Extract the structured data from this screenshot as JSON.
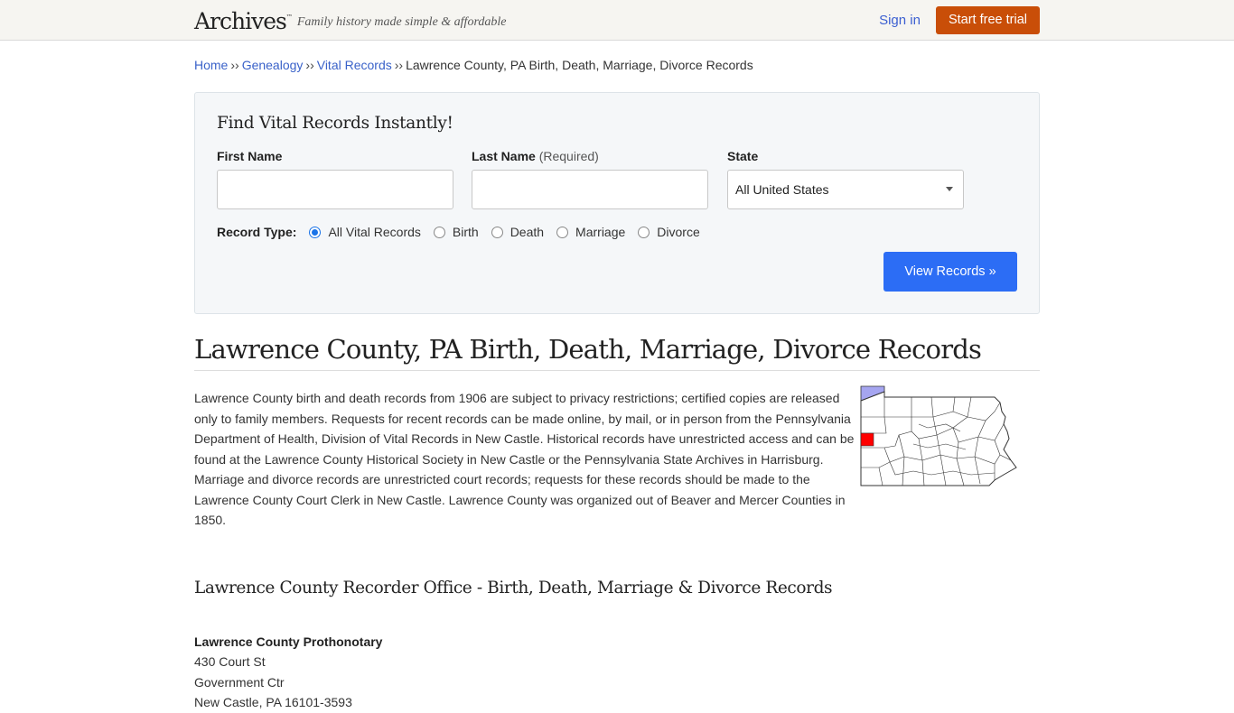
{
  "header": {
    "logo": "Archives",
    "logo_mark": "™",
    "tagline": "Family history made simple & affordable",
    "sign_in": "Sign in",
    "trial_button": "Start free trial"
  },
  "breadcrumb": {
    "items": [
      "Home",
      "Genealogy",
      "Vital Records"
    ],
    "separator": "››",
    "current": "Lawrence County, PA Birth, Death, Marriage, Divorce Records"
  },
  "search": {
    "title": "Find Vital Records Instantly!",
    "first_name_label": "First Name",
    "first_name_value": "",
    "last_name_label": "Last Name",
    "last_name_required": "(Required)",
    "last_name_value": "",
    "state_label": "State",
    "state_value": "All United States",
    "record_type_label": "Record Type:",
    "record_types": [
      {
        "label": "All Vital Records",
        "checked": true
      },
      {
        "label": "Birth",
        "checked": false
      },
      {
        "label": "Death",
        "checked": false
      },
      {
        "label": "Marriage",
        "checked": false
      },
      {
        "label": "Divorce",
        "checked": false
      }
    ],
    "submit": "View Records »"
  },
  "main": {
    "title": "Lawrence County, PA Birth, Death, Marriage, Divorce Records",
    "description": "Lawrence County birth and death records from 1906 are subject to privacy restrictions; certified copies are released only to family members. Requests for recent records can be made online, by mail, or in person from the Pennsylvania Department of Health, Division of Vital Records in New Castle. Historical records have unrestricted access and can be found at the Lawrence County Historical Society in New Castle or the Pennsylvania State Archives in Harrisburg. Marriage and divorce records are unrestricted court records; requests for these records should be made to the Lawrence County Court Clerk in New Castle. Lawrence County was organized out of Beaver and Mercer Counties in 1850.",
    "map_highlight_color": "#ff0000",
    "map_lake_color": "#a5a5f0",
    "office_heading": "Lawrence County Recorder Office - Birth, Death, Marriage & Divorce Records",
    "office": {
      "name": "Lawrence County Prothonotary",
      "address_lines": [
        "430 Court St",
        "Government Ctr",
        "New Castle, PA 16101-3593"
      ]
    }
  }
}
